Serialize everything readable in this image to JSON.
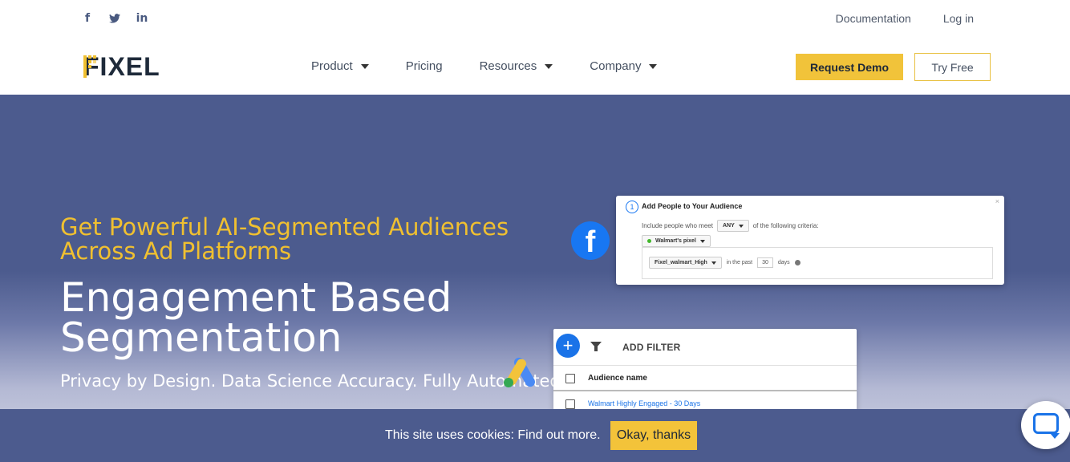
{
  "header": {
    "social": [
      {
        "name": "facebook-icon",
        "glyph": "f"
      },
      {
        "name": "twitter-icon",
        "glyph": "🐦"
      },
      {
        "name": "linkedin-icon",
        "glyph": "in"
      }
    ],
    "top_links": {
      "documentation": "Documentation",
      "login": "Log in"
    },
    "logo_text": "FIXEL",
    "nav": [
      {
        "label": "Product",
        "has_dropdown": true
      },
      {
        "label": "Pricing",
        "has_dropdown": false
      },
      {
        "label": "Resources",
        "has_dropdown": true
      },
      {
        "label": "Company",
        "has_dropdown": true
      }
    ],
    "request_demo": "Request Demo",
    "try_free": "Try Free"
  },
  "hero": {
    "eyebrow": "Get Powerful AI-Segmented Audiences Across Ad Platforms",
    "headline": "Engagement Based Segmentation",
    "subline": "Privacy by Design. Data Science Accuracy. Fully Automated."
  },
  "fb_card": {
    "step": "1",
    "title": "Add People to Your Audience",
    "include_prefix": "Include people who meet",
    "match": "ANY",
    "include_suffix": "of the following criteria:",
    "pixel": "Walmart's pixel",
    "event": "Fixel_walmart_High",
    "in_past": "in the past",
    "days_value": "30",
    "days": "days"
  },
  "ga_card": {
    "add": "+",
    "filter": "ADD FILTER",
    "column": "Audience name",
    "row": "Walmart Highly Engaged - 30 Days"
  },
  "cookie": {
    "text": "This site uses cookies: Find out more.",
    "button": "Okay, thanks"
  },
  "colors": {
    "accent": "#f1c33a",
    "hero_bg": "#4c5b8e",
    "facebook": "#1877f2",
    "google_blue": "#1a73e8"
  }
}
